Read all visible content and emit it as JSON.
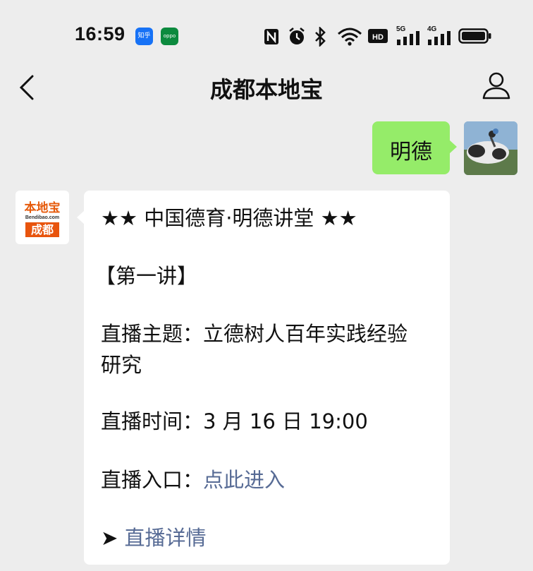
{
  "status_bar": {
    "time": "16:59",
    "apps": [
      {
        "name": "zhihu",
        "label": "知乎",
        "color": "#1772f6"
      },
      {
        "name": "oppo",
        "label": "oppo",
        "color": "#0c8a3e"
      }
    ],
    "icons": [
      "nfc-icon",
      "alarm-icon",
      "bluetooth-icon",
      "wifi-icon",
      "hd-icon",
      "signal-5g-icon",
      "signal-4g-icon",
      "battery-icon"
    ],
    "hd_label": "HD",
    "net1": "5G",
    "net2": "4G"
  },
  "nav": {
    "title": "成都本地宝"
  },
  "messages": {
    "sent_text": "明德",
    "bot_logo": {
      "top": "本地宝",
      "mid": "Bendibao.com",
      "bottom": "成都"
    },
    "card": {
      "title": "★★ 中国德育·明德讲堂 ★★",
      "lecture": "【第一讲】",
      "topic_line1": "直播主题：立德树人百年实践经验",
      "topic_line2": "研究",
      "time_line": "直播时间：3 月 16 日 19:00",
      "entry_label": "直播入口：",
      "entry_link": "点此进入",
      "detail_arrow": "➤",
      "detail_link": "直播详情"
    }
  },
  "colors": {
    "background": "#ededed",
    "sent_bubble": "#95ec69",
    "link": "#576b95",
    "brand_orange": "#e8540d"
  }
}
